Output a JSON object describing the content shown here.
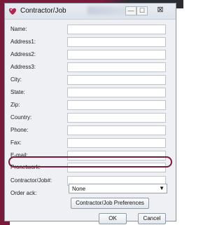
{
  "window": {
    "title": "Contractor/Job",
    "controls": {
      "minimize": "—",
      "maximize": "☐",
      "close": "⊠"
    }
  },
  "form": {
    "fields": [
      {
        "label": "Name:",
        "value": ""
      },
      {
        "label": "Address1:",
        "value": ""
      },
      {
        "label": "Address2:",
        "value": ""
      },
      {
        "label": "Address3:",
        "value": ""
      },
      {
        "label": "City:",
        "value": ""
      },
      {
        "label": "State:",
        "value": ""
      },
      {
        "label": "Zip:",
        "value": ""
      },
      {
        "label": "Country:",
        "value": ""
      },
      {
        "label": "Phone:",
        "value": ""
      },
      {
        "label": "Fax:",
        "value": ""
      },
      {
        "label": "E-mail:",
        "value": ""
      },
      {
        "label": "Pronetwork:",
        "value": ""
      },
      {
        "label": "Contractor/Job#:",
        "value": ""
      }
    ],
    "order_ack": {
      "label": "Order ack:",
      "selected": "None"
    }
  },
  "buttons": {
    "preferences": "Contractor/Job Preferences",
    "ok": "OK",
    "cancel": "Cancel"
  },
  "colors": {
    "accent": "#7a1a3a"
  }
}
